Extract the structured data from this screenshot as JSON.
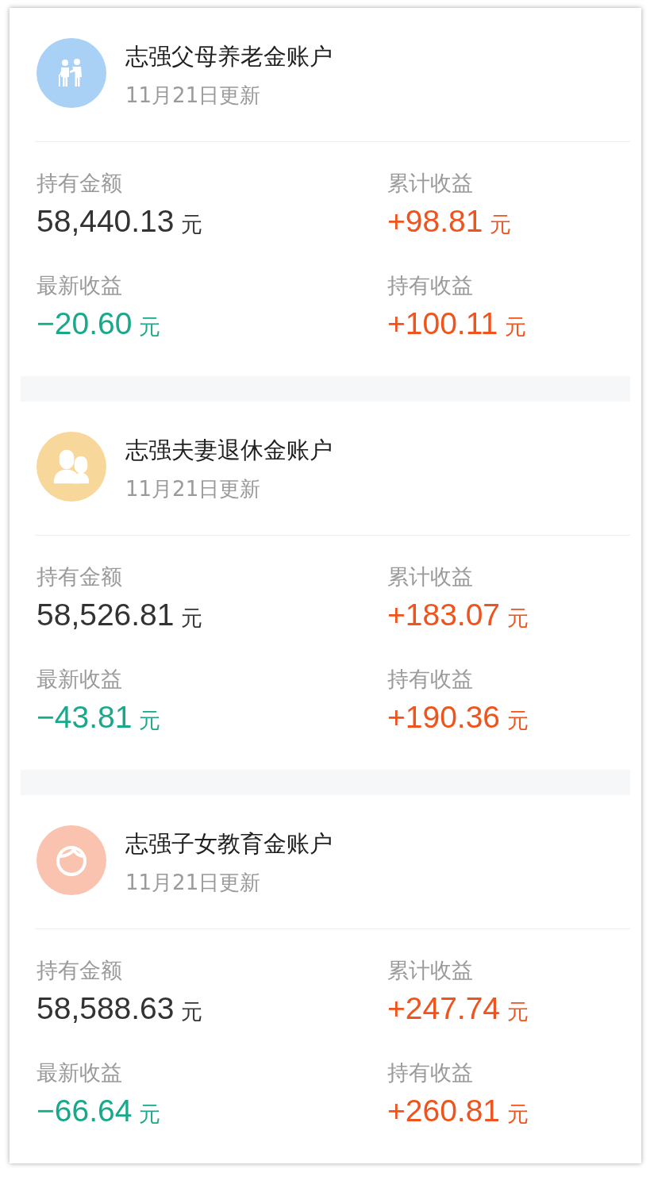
{
  "accounts": [
    {
      "kind": "elderly",
      "color": "#a9d0f5",
      "title": "志强父母养老金账户",
      "updated": "11月21日更新",
      "stats": [
        {
          "label": "持有金额",
          "value": "58,440.13",
          "unit": "元",
          "kind": "neutral"
        },
        {
          "label": "累计收益",
          "value": "+98.81",
          "unit": "元",
          "kind": "up"
        },
        {
          "label": "最新收益",
          "value": "−20.60",
          "unit": "元",
          "kind": "down"
        },
        {
          "label": "持有收益",
          "value": "+100.11",
          "unit": "元",
          "kind": "up"
        }
      ]
    },
    {
      "kind": "couple",
      "color": "#f8d79a",
      "title": "志强夫妻退休金账户",
      "updated": "11月21日更新",
      "stats": [
        {
          "label": "持有金额",
          "value": "58,526.81",
          "unit": "元",
          "kind": "neutral"
        },
        {
          "label": "累计收益",
          "value": "+183.07",
          "unit": "元",
          "kind": "up"
        },
        {
          "label": "最新收益",
          "value": "−43.81",
          "unit": "元",
          "kind": "down"
        },
        {
          "label": "持有收益",
          "value": "+190.36",
          "unit": "元",
          "kind": "up"
        }
      ]
    },
    {
      "kind": "child",
      "color": "#f9c3b0",
      "title": "志强子女教育金账户",
      "updated": "11月21日更新",
      "stats": [
        {
          "label": "持有金额",
          "value": "58,588.63",
          "unit": "元",
          "kind": "neutral"
        },
        {
          "label": "累计收益",
          "value": "+247.74",
          "unit": "元",
          "kind": "up"
        },
        {
          "label": "最新收益",
          "value": "−66.64",
          "unit": "元",
          "kind": "down"
        },
        {
          "label": "持有收益",
          "value": "+260.81",
          "unit": "元",
          "kind": "up"
        }
      ]
    }
  ]
}
